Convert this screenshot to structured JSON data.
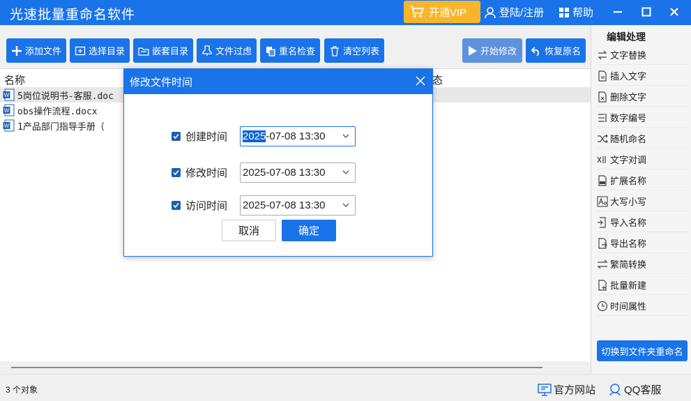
{
  "app": {
    "title": "光速批量重命名软件",
    "vip_label": "开通VIP",
    "login_label": "登陆/注册",
    "help_label": "帮助"
  },
  "toolbar": {
    "add_file": "添加文件",
    "select_dir": "选择目录",
    "nested_dir": "嵌套目录",
    "file_filter": "文件过虑",
    "rename_check": "重名检查",
    "clear_list": "清空列表",
    "start_modify": "开始修改",
    "restore_name": "恢复原名"
  },
  "list": {
    "col_name": "名称",
    "col_status": "态",
    "rows": [
      {
        "name": "5岗位说明书-客服.doc"
      },
      {
        "name": "obs操作流程.docx"
      },
      {
        "name": "1产品部门指导手册（"
      }
    ]
  },
  "side": {
    "title": "编辑处理",
    "items": [
      {
        "label": "文字替换"
      },
      {
        "label": "插入文字"
      },
      {
        "label": "删除文字"
      },
      {
        "label": "数字编号"
      },
      {
        "label": "随机命名"
      },
      {
        "label": "文字对调"
      },
      {
        "label": "扩展名称"
      },
      {
        "label": "大写小写"
      },
      {
        "label": "导入名称"
      },
      {
        "label": "导出名称"
      },
      {
        "label": "繁简转换"
      },
      {
        "label": "批量新建"
      },
      {
        "label": "时间属性"
      }
    ],
    "switch_label": "切换到文件夹重命名"
  },
  "status": {
    "count": "3 个对象",
    "official_site": "官方网站",
    "qq_service": "QQ客服"
  },
  "dialog": {
    "title": "修改文件时间",
    "rows": [
      {
        "label": "创建时间",
        "year": "2025",
        "rest": "-07-08 13:30",
        "checked": true
      },
      {
        "label": "修改时间",
        "year": "2025",
        "rest": "-07-08 13:30",
        "checked": true
      },
      {
        "label": "访问时间",
        "year": "2025",
        "rest": "-07-08 13:30",
        "checked": true
      }
    ],
    "cancel_label": "取消",
    "ok_label": "确定"
  },
  "colors": {
    "accent": "#1a73e8",
    "vip": "#f9b52a"
  }
}
